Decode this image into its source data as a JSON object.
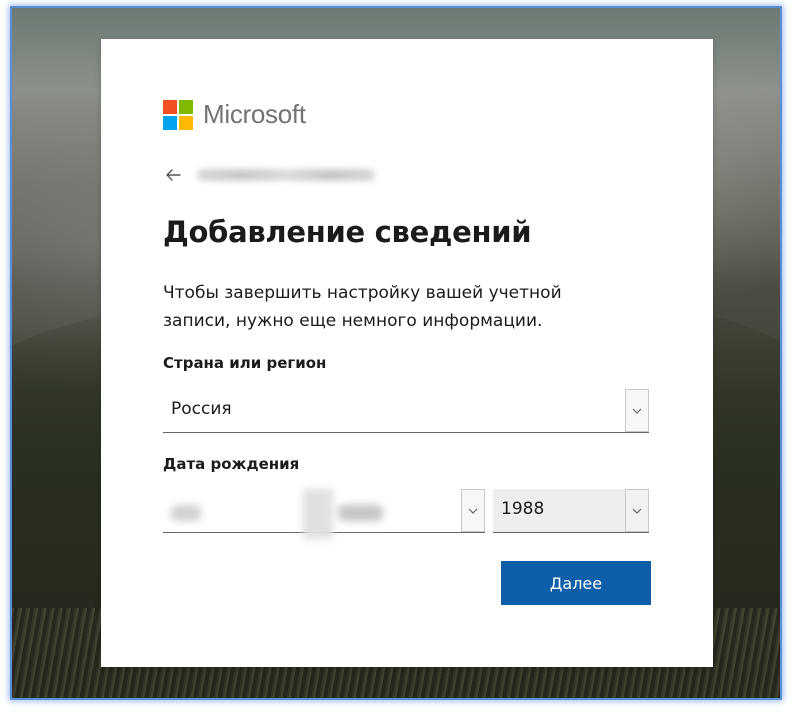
{
  "brand": {
    "name": "Microsoft",
    "logo_colors": [
      "#f25022",
      "#7fba00",
      "#00a4ef",
      "#ffb900"
    ],
    "text_color": "#737373"
  },
  "back": {
    "icon": "arrow-left-icon"
  },
  "header": {
    "title": "Добавление сведений"
  },
  "description": "Чтобы завершить настройку вашей учетной записи, нужно еще немного информации.",
  "country": {
    "label": "Страна или регион",
    "value": "Россия",
    "icon": "chevron-down-icon"
  },
  "birthdate": {
    "label": "Дата рождения",
    "year": "1988",
    "icon": "chevron-down-icon"
  },
  "actions": {
    "next_label": "Далее",
    "next_color": "#0f5ea8"
  },
  "theme": {
    "frame_glow": "#5a8fd8"
  }
}
